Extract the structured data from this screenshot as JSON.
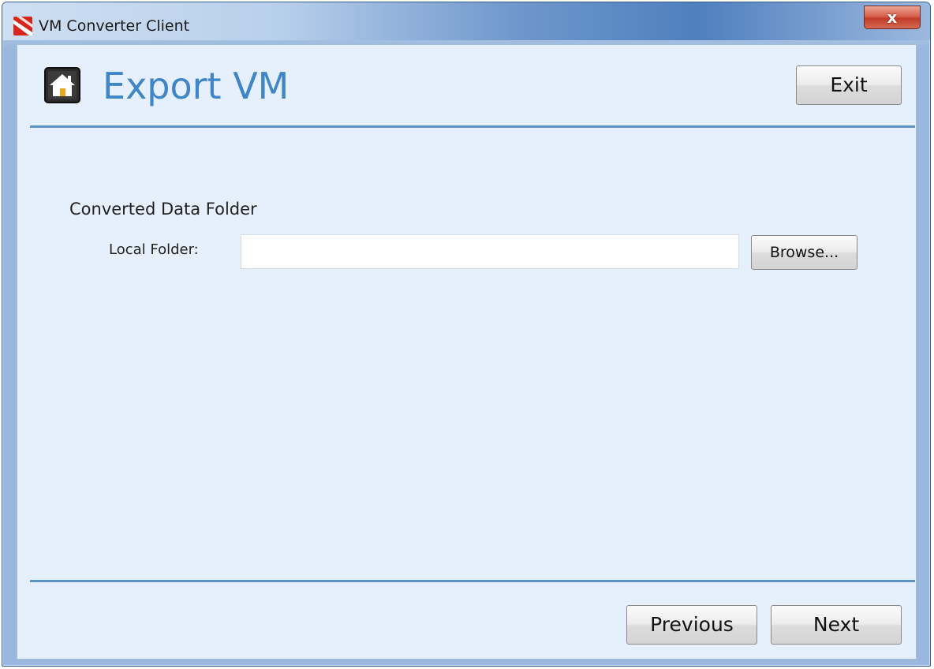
{
  "window": {
    "title": "VM Converter Client",
    "close_label": "x"
  },
  "header": {
    "page_title": "Export VM",
    "exit_label": "Exit"
  },
  "form": {
    "section_title": "Converted Data Folder",
    "local_folder_label": "Local Folder:",
    "local_folder_value": "",
    "local_folder_placeholder": "",
    "browse_label": "Browse..."
  },
  "footer": {
    "previous_label": "Previous",
    "next_label": "Next"
  },
  "icons": {
    "app": "vm-converter-app-icon",
    "home": "home-icon",
    "close": "close-icon"
  },
  "colors": {
    "title_accent": "#3f86c7",
    "rule": "#5f93c8",
    "client_background": "#e6effc",
    "close_button": "#c23c2a"
  }
}
